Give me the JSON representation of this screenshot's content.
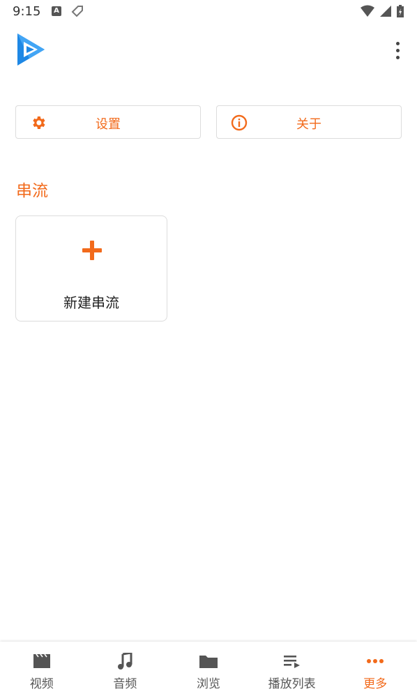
{
  "status_bar": {
    "time": "9:15",
    "notification_letter": "A"
  },
  "app_bar": {
    "logo_icon": "play-arrow-logo-icon",
    "overflow_icon": "more-vert-icon"
  },
  "actions": {
    "settings": {
      "label": "设置",
      "icon": "gear-icon"
    },
    "about": {
      "label": "关于",
      "icon": "info-icon"
    }
  },
  "section": {
    "title": "串流"
  },
  "new_stream": {
    "label": "新建串流",
    "icon": "plus-icon"
  },
  "bottom_nav": {
    "items": [
      {
        "label": "视频",
        "icon": "movie-icon",
        "active": false
      },
      {
        "label": "音频",
        "icon": "music-note-icon",
        "active": false
      },
      {
        "label": "浏览",
        "icon": "folder-icon",
        "active": false
      },
      {
        "label": "播放列表",
        "icon": "playlist-icon",
        "active": false
      },
      {
        "label": "更多",
        "icon": "more-horiz-icon",
        "active": true
      }
    ]
  },
  "colors": {
    "accent": "#f26a1b",
    "logo_blue": "#1e88e5",
    "border": "#dcdcdc"
  }
}
